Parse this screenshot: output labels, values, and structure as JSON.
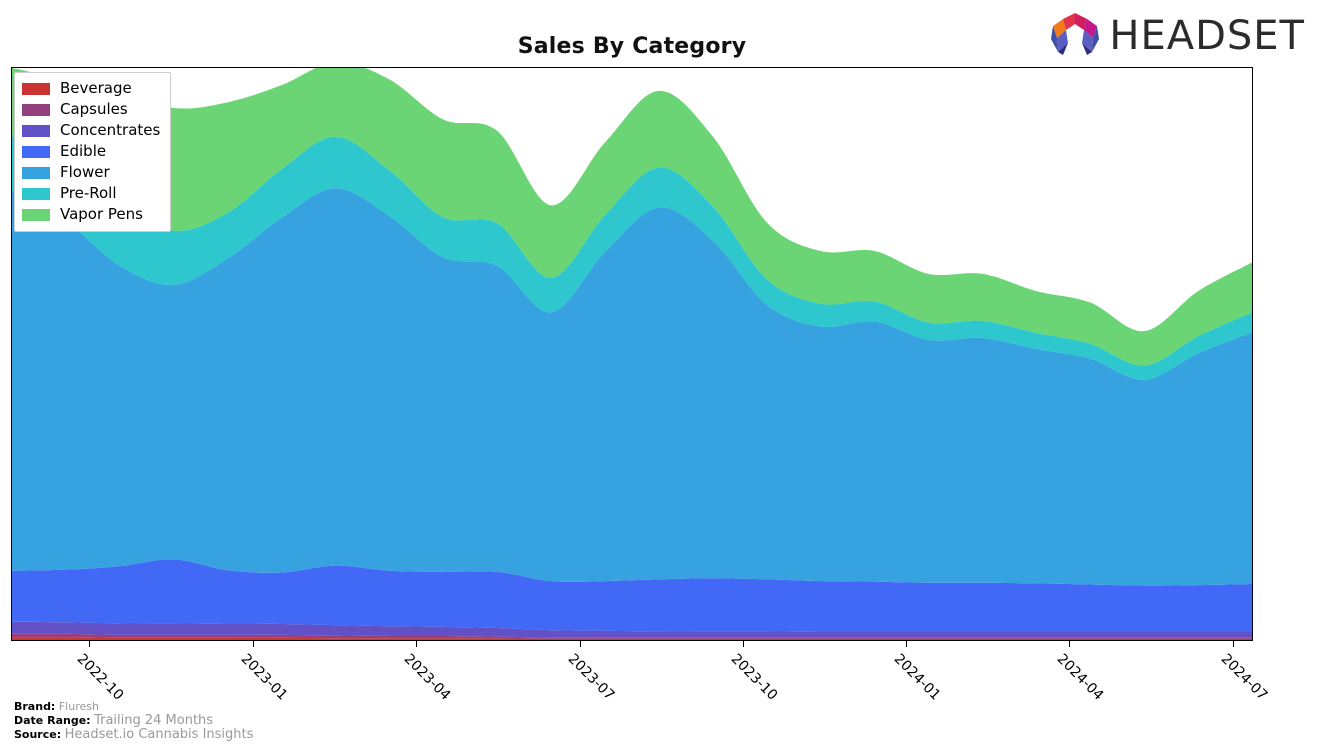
{
  "header": {
    "title": "Sales By Category",
    "logo_text": "HEADSET",
    "logo_icon": "headset-hexagon-logo"
  },
  "legend": {
    "position": "upper-left",
    "items": [
      {
        "label": "Beverage",
        "color": "#cc3333"
      },
      {
        "label": "Capsules",
        "color": "#94407f"
      },
      {
        "label": "Concentrates",
        "color": "#6150c6"
      },
      {
        "label": "Edible",
        "color": "#4169f5"
      },
      {
        "label": "Flower",
        "color": "#36a2e0"
      },
      {
        "label": "Pre-Roll",
        "color": "#2ec7ce"
      },
      {
        "label": "Vapor Pens",
        "color": "#6bd575"
      }
    ]
  },
  "footer": {
    "brand_key": "Brand:",
    "brand_value": "Fluresh",
    "date_range_key": "Date Range:",
    "date_range_value": "Trailing 24 Months",
    "source_key": "Source:",
    "source_value": "Headset.io Cannabis Insights"
  },
  "chart_data": {
    "type": "area",
    "stacked": true,
    "title": "Sales By Category",
    "xlabel": "",
    "ylabel": "",
    "grid": false,
    "legend_position": "upper-left",
    "axis_ticks_visible": {
      "x": true,
      "y": false
    },
    "xlim": [
      "2022-09",
      "2024-08"
    ],
    "ylim": [
      0,
      100
    ],
    "tick_labels": [
      "2022-10",
      "2023-01",
      "2023-04",
      "2023-07",
      "2023-10",
      "2024-01",
      "2024-04",
      "2024-07"
    ],
    "tick_positions_pct": [
      6.25,
      19.5,
      32.6,
      45.8,
      58.9,
      72.1,
      85.2,
      98.4
    ],
    "x": [
      "2022-09",
      "2022-10",
      "2022-11",
      "2022-12",
      "2023-01",
      "2023-02",
      "2023-03",
      "2023-04",
      "2023-05",
      "2023-06",
      "2023-07",
      "2023-08",
      "2023-09",
      "2023-10",
      "2023-11",
      "2023-12",
      "2024-01",
      "2024-02",
      "2024-03",
      "2024-04",
      "2024-05",
      "2024-06",
      "2024-07",
      "2024-08"
    ],
    "series": [
      {
        "name": "Beverage",
        "color": "#cc3333",
        "values": [
          0.5,
          0.5,
          0.4,
          0.4,
          0.4,
          0.4,
          0.3,
          0.3,
          0.3,
          0.3,
          0.2,
          0.2,
          0.2,
          0.2,
          0.2,
          0.2,
          0.2,
          0.2,
          0.2,
          0.2,
          0.2,
          0.2,
          0.2,
          0.2
        ]
      },
      {
        "name": "Capsules",
        "color": "#94407f",
        "values": [
          0.6,
          0.6,
          0.5,
          0.5,
          0.5,
          0.5,
          0.5,
          0.4,
          0.4,
          0.3,
          0.2,
          0.2,
          0.2,
          0.2,
          0.2,
          0.2,
          0.2,
          0.2,
          0.2,
          0.2,
          0.2,
          0.2,
          0.2,
          0.2
        ]
      },
      {
        "name": "Concentrates",
        "color": "#6150c6",
        "values": [
          2.1,
          2.0,
          2.0,
          2.0,
          1.9,
          1.9,
          1.8,
          1.7,
          1.6,
          1.5,
          1.3,
          1.2,
          1.1,
          1.1,
          1.1,
          1.0,
          1.0,
          1.0,
          1.0,
          1.0,
          1.0,
          1.0,
          1.0,
          1.0
        ]
      },
      {
        "name": "Edible",
        "color": "#4169f5",
        "values": [
          8.9,
          9.2,
          10.0,
          11.2,
          9.4,
          9.0,
          10.4,
          9.7,
          9.6,
          9.8,
          8.6,
          8.7,
          9.1,
          9.3,
          9.1,
          8.9,
          8.8,
          8.6,
          8.6,
          8.5,
          8.3,
          8.1,
          8.2,
          8.4
        ]
      },
      {
        "name": "Flower",
        "color": "#36a2e0",
        "values": [
          66.5,
          61.0,
          52.5,
          48.0,
          54.5,
          62.0,
          66.0,
          62.0,
          55.0,
          53.5,
          47.0,
          57.5,
          65.0,
          59.0,
          48.0,
          44.5,
          45.5,
          42.5,
          42.8,
          41.0,
          39.5,
          36.0,
          40.5,
          44.0
        ]
      },
      {
        "name": "Pre-Roll",
        "color": "#2ec7ce",
        "values": [
          9.5,
          10.5,
          11.5,
          9.5,
          8.0,
          8.5,
          9.0,
          8.0,
          7.0,
          7.5,
          6.0,
          6.5,
          7.0,
          6.0,
          4.5,
          4.0,
          3.5,
          3.0,
          3.0,
          2.8,
          2.6,
          2.5,
          3.0,
          3.5
        ]
      },
      {
        "name": "Vapor Pens",
        "color": "#6bd575",
        "values": [
          11.9,
          14.2,
          19.1,
          21.4,
          19.3,
          14.7,
          13.0,
          15.9,
          17.1,
          16.1,
          12.7,
          12.7,
          13.4,
          12.2,
          9.9,
          9.2,
          8.8,
          8.5,
          8.2,
          7.3,
          7.2,
          6.0,
          7.9,
          8.7
        ]
      }
    ]
  }
}
